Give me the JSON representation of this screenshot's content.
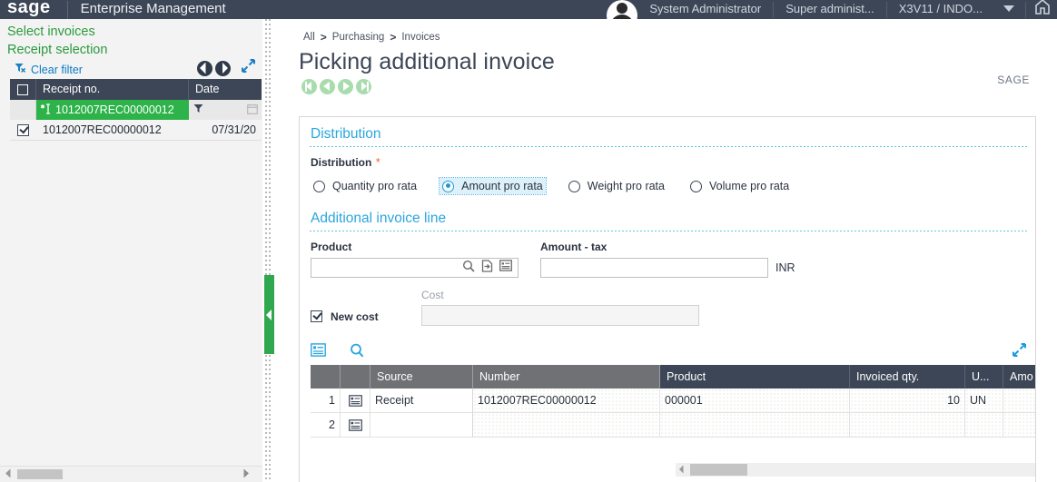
{
  "topbar": {
    "brand": "sage",
    "product": "Enterprise Management",
    "user": "System Administrator",
    "role": "Super administ...",
    "folder": "X3V11 / INDO...",
    "avatar_icon": "user-avatar-icon",
    "caret_icon": "chevron-down-icon",
    "home_icon": "home-icon"
  },
  "sidebar": {
    "title": "Select invoices",
    "subtitle": "Receipt selection",
    "clear_filter": "Clear filter",
    "filter_icon": "filter-clear-icon",
    "prev_icon": "circle-left-arrow-icon",
    "next_icon": "circle-right-arrow-icon",
    "expand_icon": "expand-diagonal-icon",
    "columns": [
      "Receipt no.",
      "Date"
    ],
    "filter_row": {
      "value": "1012007REC00000012",
      "marker_icon": "text-cursor-star-icon",
      "date_filter_icon": "funnel-icon",
      "calendar_icon": "calendar-icon"
    },
    "rows": [
      {
        "checked": true,
        "receipt_no": "1012007REC00000012",
        "date": "07/31/20"
      }
    ],
    "scroll_left_icon": "scroll-left-arrow-icon",
    "scroll_right_icon": "scroll-right-arrow-icon"
  },
  "splitter": {
    "collapse_icon": "collapse-left-chevron-icon"
  },
  "main": {
    "breadcrumb": [
      "All",
      "Purchasing",
      "Invoices"
    ],
    "breadcrumb_sep": ">",
    "page_title": "Picking additional invoice",
    "record_nav": [
      {
        "name": "first-record-button",
        "icon": "first-record-icon"
      },
      {
        "name": "previous-record-button",
        "icon": "previous-record-icon"
      },
      {
        "name": "next-record-button",
        "icon": "next-record-icon"
      },
      {
        "name": "last-record-button",
        "icon": "last-record-icon"
      }
    ],
    "watermark": "SAGE",
    "distribution": {
      "section_title": "Distribution",
      "field_label": "Distribution",
      "required_marker": "*",
      "options": [
        {
          "label": "Quantity pro rata",
          "selected": false
        },
        {
          "label": "Amount pro rata",
          "selected": true
        },
        {
          "label": "Weight pro rata",
          "selected": false
        },
        {
          "label": "Volume pro rata",
          "selected": false
        }
      ]
    },
    "invoice_line": {
      "section_title": "Additional invoice line",
      "product_label": "Product",
      "product_value": "",
      "product_icons": [
        "search-icon",
        "jump-to-record-icon",
        "selection-list-icon"
      ],
      "amount_label": "Amount - tax",
      "amount_value": "",
      "currency": "INR",
      "new_cost_label": "New cost",
      "new_cost_checked": true,
      "cost_label": "Cost",
      "cost_value": "",
      "cost_disabled": true
    },
    "grid": {
      "toolbar_icons": [
        "grid-detail-icon",
        "grid-search-icon"
      ],
      "expand_icon": "expand-diagonal-icon",
      "columns": [
        "",
        "",
        "Source",
        "Number",
        "Product",
        "Invoiced qty.",
        "U...",
        "Amo"
      ],
      "rows": [
        {
          "index": "1",
          "row_icon": "row-detail-icon",
          "source": "Receipt",
          "number": "1012007REC00000012",
          "product": "000001",
          "invoiced_qty": "10",
          "unit": "UN",
          "amount": ""
        },
        {
          "index": "2",
          "row_icon": "row-detail-icon",
          "source": "",
          "number": "",
          "product": "",
          "invoiced_qty": "",
          "unit": "",
          "amount": ""
        }
      ],
      "scroll_left_icon": "scroll-left-arrow-icon",
      "scroll_right_icon": "scroll-right-arrow-icon"
    }
  },
  "colors": {
    "header_navy": "#3d4656",
    "sage_green": "#2db34a",
    "accent_blue": "#2ba6de",
    "link_blue": "#0a7bc4",
    "required_orange": "#f26422",
    "nav_green": "#a8dcad"
  }
}
